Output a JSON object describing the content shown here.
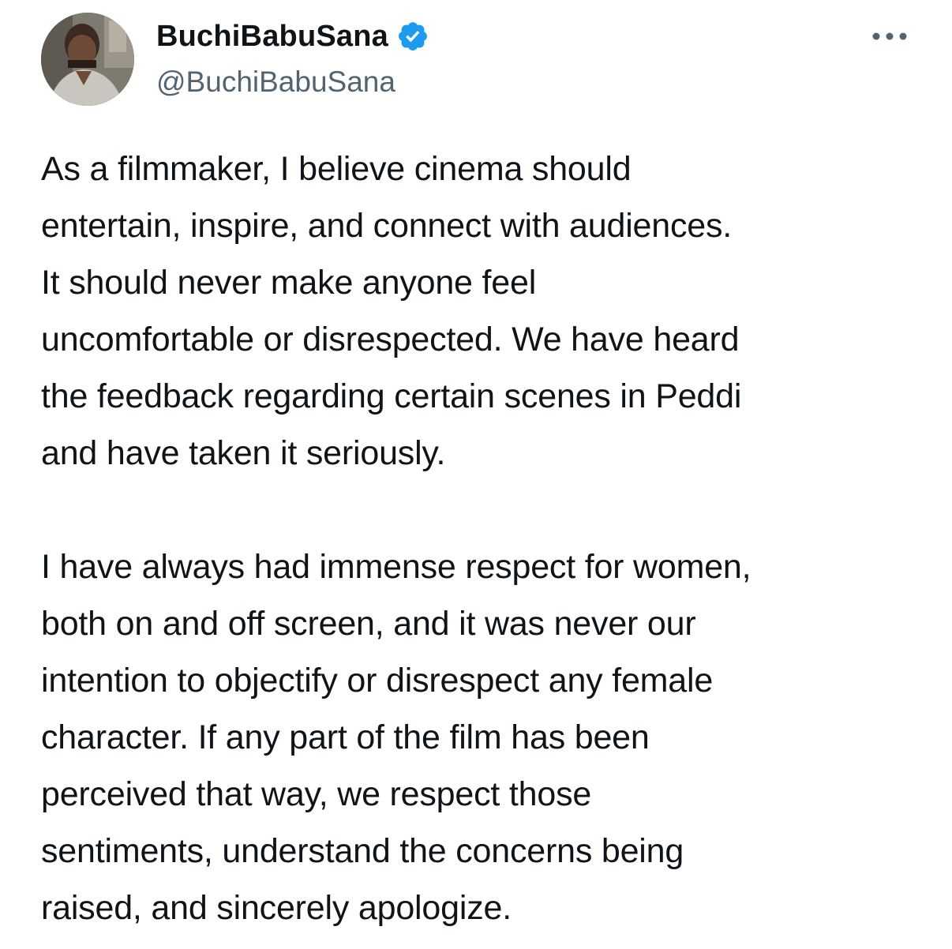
{
  "author": {
    "display_name": "BuchiBabuSana",
    "handle": "@BuchiBabuSana",
    "verified": true,
    "verified_color": "#1d9bf0",
    "avatar_icon": "profile-photo"
  },
  "menu": {
    "icon": "more-options-icon"
  },
  "tweet": {
    "paragraph_1": [
      "As a filmmaker, I believe cinema should",
      "entertain, inspire, and connect with audiences.",
      "It should never make anyone feel",
      "uncomfortable or disrespected. We have heard",
      "the feedback regarding certain scenes in Peddi",
      "and have taken it seriously."
    ],
    "paragraph_2": [
      "I have always had immense respect for women,",
      "both on and off screen, and it was never our",
      "intention to objectify or disrespect any female",
      "character. If any part of the film has been",
      "perceived that way, we respect those",
      "sentiments, understand the concerns being",
      "raised, and sincerely apologize."
    ]
  },
  "colors": {
    "text": "#0f1419",
    "secondary_text": "#536471",
    "background": "#ffffff"
  }
}
